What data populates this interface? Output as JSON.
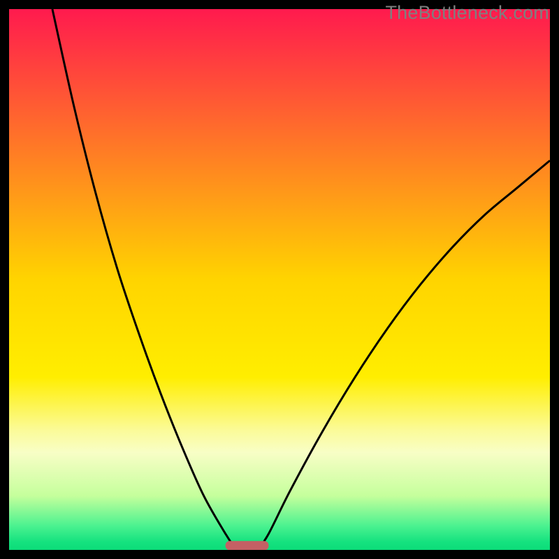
{
  "watermark": "TheBottleneck.com",
  "chart_data": {
    "type": "line",
    "title": "",
    "xlabel": "",
    "ylabel": "",
    "xlim": [
      0,
      100
    ],
    "ylim": [
      0,
      100
    ],
    "grid": false,
    "legend": false,
    "background_gradient": {
      "stops": [
        {
          "offset": 0.0,
          "color": "#ff1a4e"
        },
        {
          "offset": 0.5,
          "color": "#ffd400"
        },
        {
          "offset": 0.68,
          "color": "#ffee00"
        },
        {
          "offset": 0.78,
          "color": "#fbfb9a"
        },
        {
          "offset": 0.82,
          "color": "#f8fec6"
        },
        {
          "offset": 0.9,
          "color": "#c5ff9c"
        },
        {
          "offset": 0.955,
          "color": "#4cf290"
        },
        {
          "offset": 0.985,
          "color": "#15e27f"
        },
        {
          "offset": 1.0,
          "color": "#0cdc79"
        }
      ]
    },
    "series": [
      {
        "name": "left-branch",
        "x": [
          8,
          12,
          16,
          20,
          24,
          28,
          32,
          36,
          40,
          42
        ],
        "y": [
          100,
          82,
          66,
          52,
          40,
          29,
          19,
          10,
          3,
          0
        ]
      },
      {
        "name": "right-branch",
        "x": [
          46,
          48,
          52,
          58,
          64,
          70,
          76,
          82,
          88,
          94,
          100
        ],
        "y": [
          0,
          3,
          11,
          22,
          32,
          41,
          49,
          56,
          62,
          67,
          72
        ]
      }
    ],
    "marker": {
      "name": "optimal-range-bar",
      "x_start": 40,
      "x_end": 48,
      "y": 0.8,
      "color": "#c46064"
    }
  }
}
